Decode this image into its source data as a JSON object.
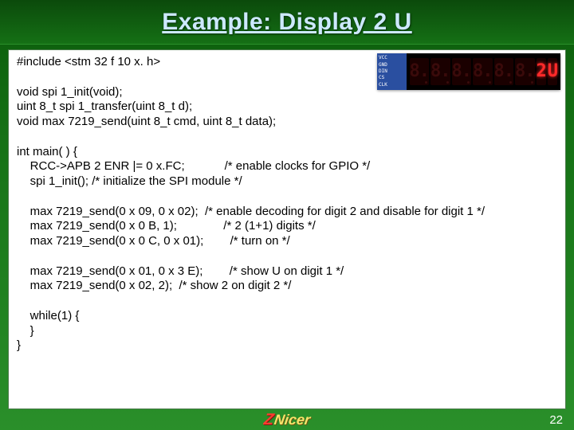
{
  "title": "Example: Display 2 U",
  "code": {
    "l01": "#include <stm 32 f 10 x. h>",
    "l02": "",
    "l03": "void spi 1_init(void);",
    "l04": "uint 8_t spi 1_transfer(uint 8_t d);",
    "l05": "void max 7219_send(uint 8_t cmd, uint 8_t data);",
    "l06": "",
    "l07": "int main( ) {",
    "l08": "    RCC->APB 2 ENR |= 0 x.FC;            /* enable clocks for GPIO */",
    "l09": "    spi 1_init(); /* initialize the SPI module */",
    "l10": "",
    "l11": "    max 7219_send(0 x 09, 0 x 02);  /* enable decoding for digit 2 and disable for digit 1 */",
    "l12": "    max 7219_send(0 x 0 B, 1);              /* 2 (1+1) digits */",
    "l13": "    max 7219_send(0 x 0 C, 0 x 01);        /* turn on */",
    "l14": "",
    "l15": "    max 7219_send(0 x 01, 0 x 3 E);        /* show U on digit 1 */",
    "l16": "    max 7219_send(0 x 02, 2);  /* show 2 on digit 2 */",
    "l17": "",
    "l18": "    while(1) {",
    "l19": "    }",
    "l20": "}"
  },
  "hardware": {
    "pins": [
      "VCC",
      "GND",
      "DIN",
      "CS",
      "CLK"
    ],
    "digits": [
      {
        "glyph": "8.",
        "on": false
      },
      {
        "glyph": "8.",
        "on": false
      },
      {
        "glyph": "8.",
        "on": false
      },
      {
        "glyph": "8.",
        "on": false
      },
      {
        "glyph": "8.",
        "on": false
      },
      {
        "glyph": "8.",
        "on": false
      },
      {
        "glyph": "2",
        "on": true
      },
      {
        "glyph": "U",
        "on": true
      }
    ]
  },
  "footer": {
    "logo_left": "Z",
    "logo_right": "Nicer",
    "page": "22"
  }
}
